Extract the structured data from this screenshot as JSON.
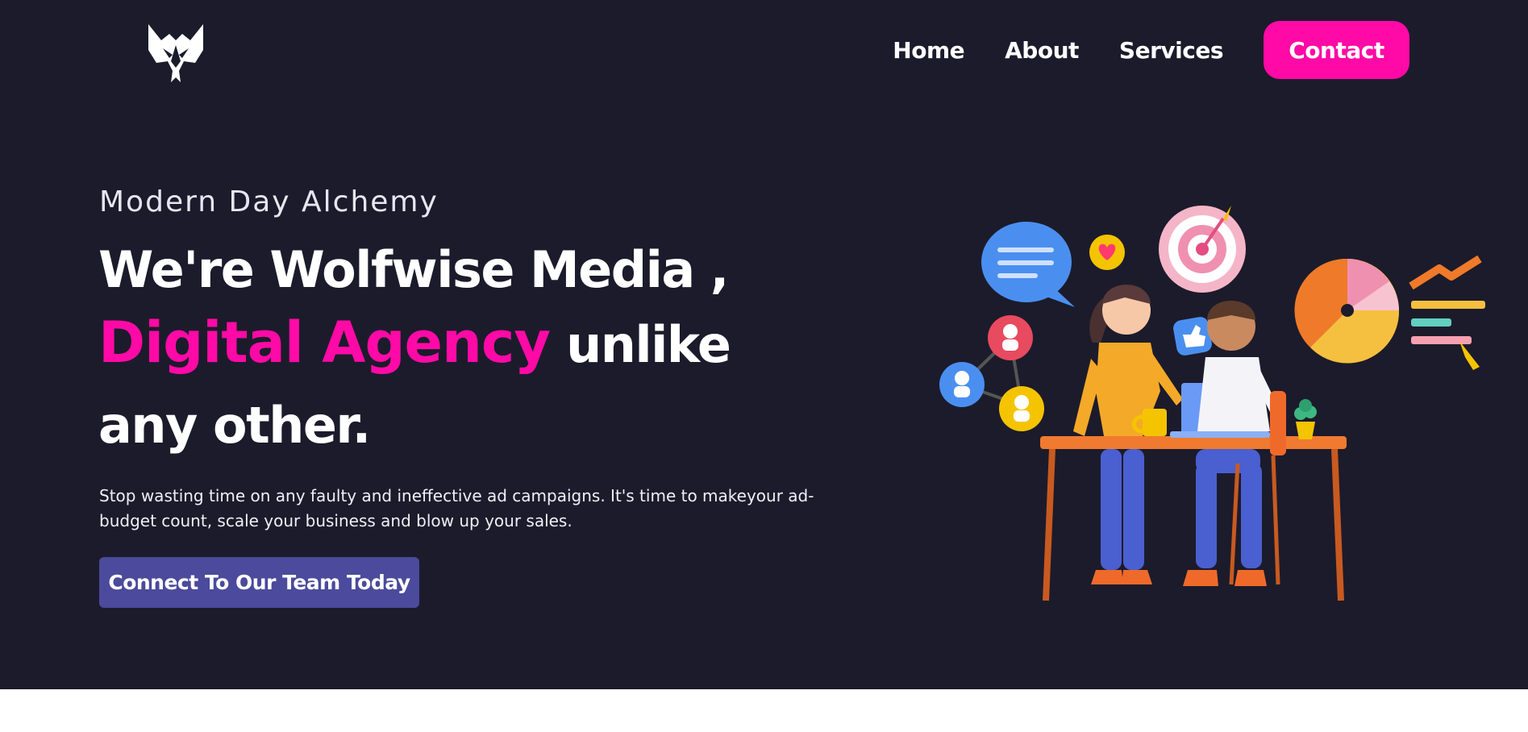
{
  "brand": {
    "logo_icon": "wolf-head-icon"
  },
  "nav": {
    "items": [
      {
        "label": "Home"
      },
      {
        "label": "About"
      },
      {
        "label": "Services"
      }
    ],
    "contact_label": "Contact"
  },
  "hero": {
    "eyebrow": "Modern Day Alchemy",
    "headline_line1": "We're Wolfwise Media ,",
    "headline_accent": "Digital Agency",
    "headline_rest": " unlike any other.",
    "subtext": "Stop wasting time on any faulty and ineffective ad campaigns. It's time to makeyour ad-budget count, scale your business and blow up your sales.",
    "cta_label": "Connect To Our Team Today"
  },
  "illustration": {
    "icon": "team-working-at-desk-illustration"
  },
  "colors": {
    "background": "#1c1b2b",
    "accent": "#ff0aa6",
    "cta": "#4b4a9c",
    "text": "#ffffff"
  }
}
